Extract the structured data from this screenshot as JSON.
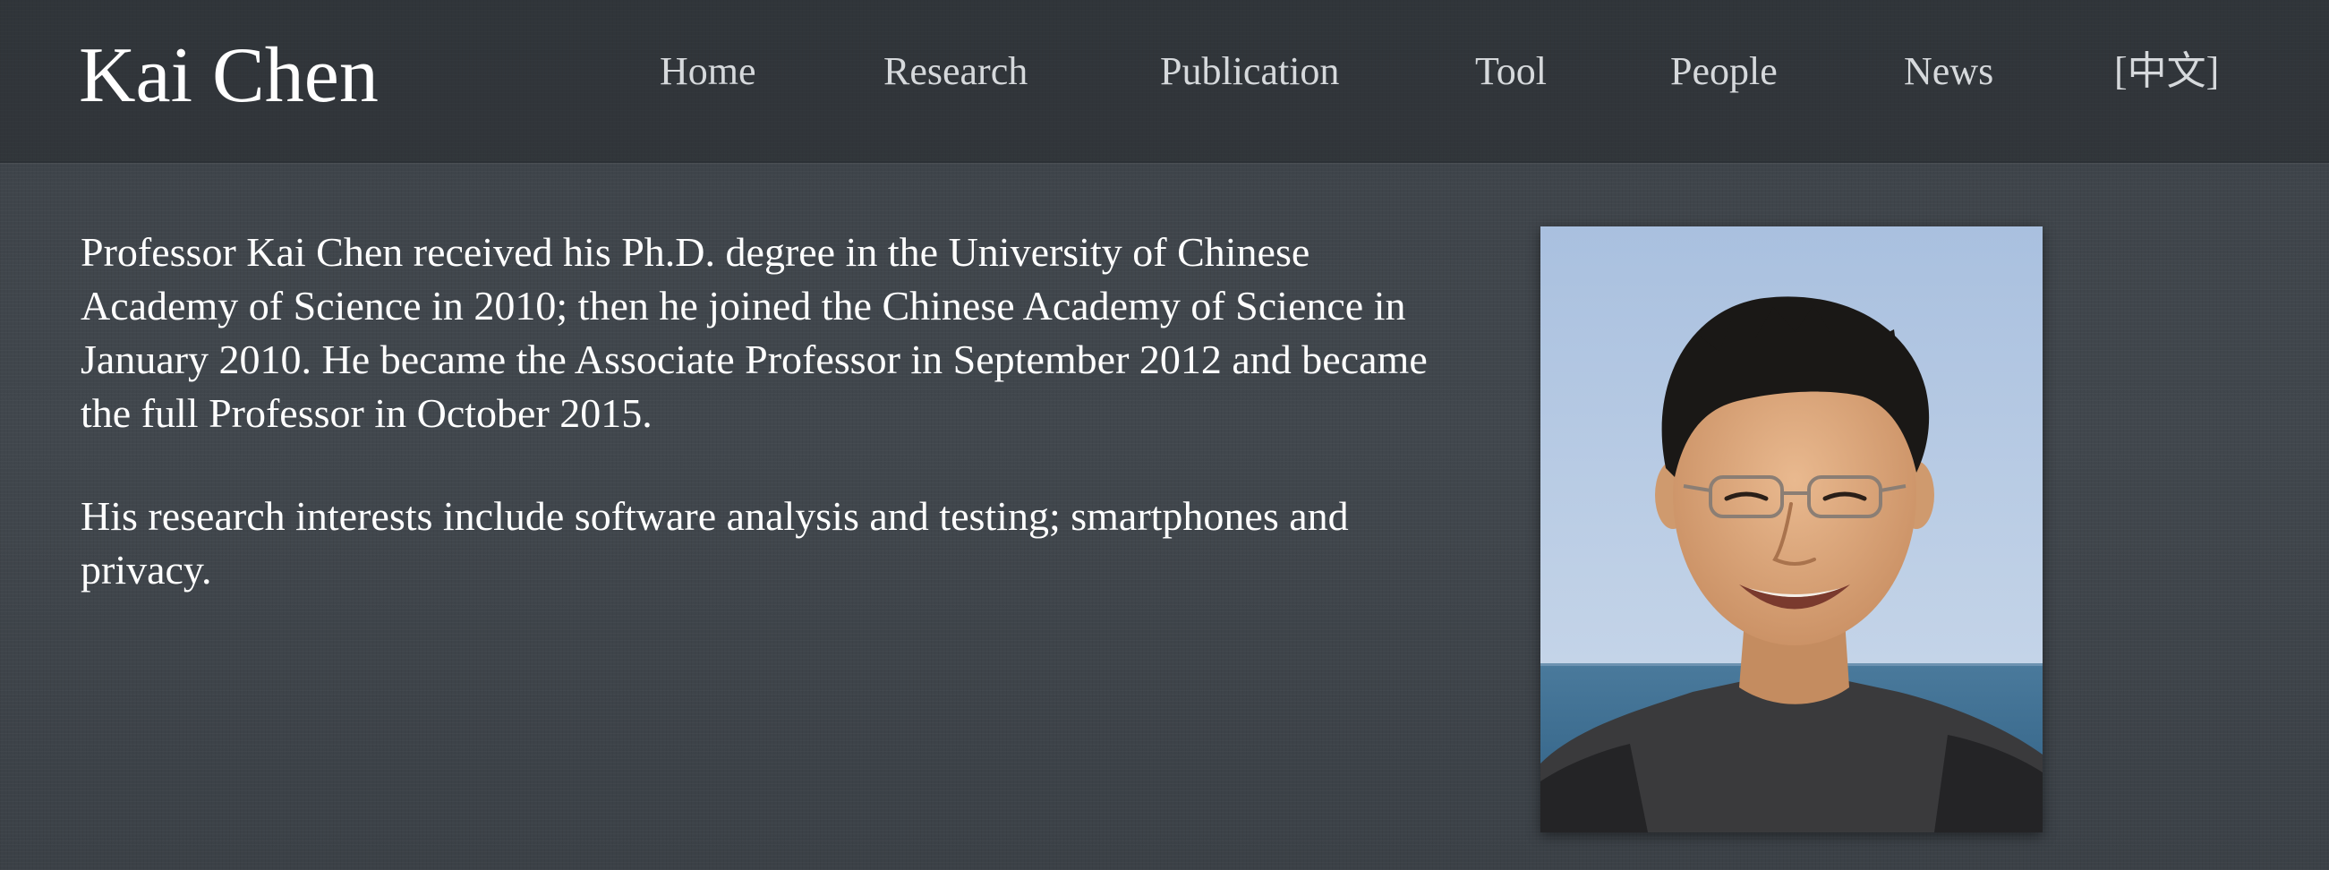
{
  "header": {
    "site_title": "Kai Chen",
    "nav": [
      {
        "label": "Home"
      },
      {
        "label": "Research"
      },
      {
        "label": "Publication"
      },
      {
        "label": "Tool"
      },
      {
        "label": "People"
      },
      {
        "label": "News"
      },
      {
        "label": "[中文]"
      }
    ]
  },
  "main": {
    "bio": [
      "Professor Kai Chen received his Ph.D. degree in the University of Chinese Academy of Science in 2010; then he joined the Chinese Academy of Science in January 2010. He became the Associate Professor in September 2012 and became the full Professor in October 2015.",
      "His research interests include software analysis and testing; smartphones and privacy."
    ],
    "portrait": {
      "subject": "portrait photo"
    }
  },
  "colors": {
    "background": "#3f454b",
    "header_background": "#2f3439",
    "nav_text": "#d6d9dc",
    "body_text": "#ffffff",
    "sky": "#b9cce4",
    "sea": "#3f6f92"
  }
}
